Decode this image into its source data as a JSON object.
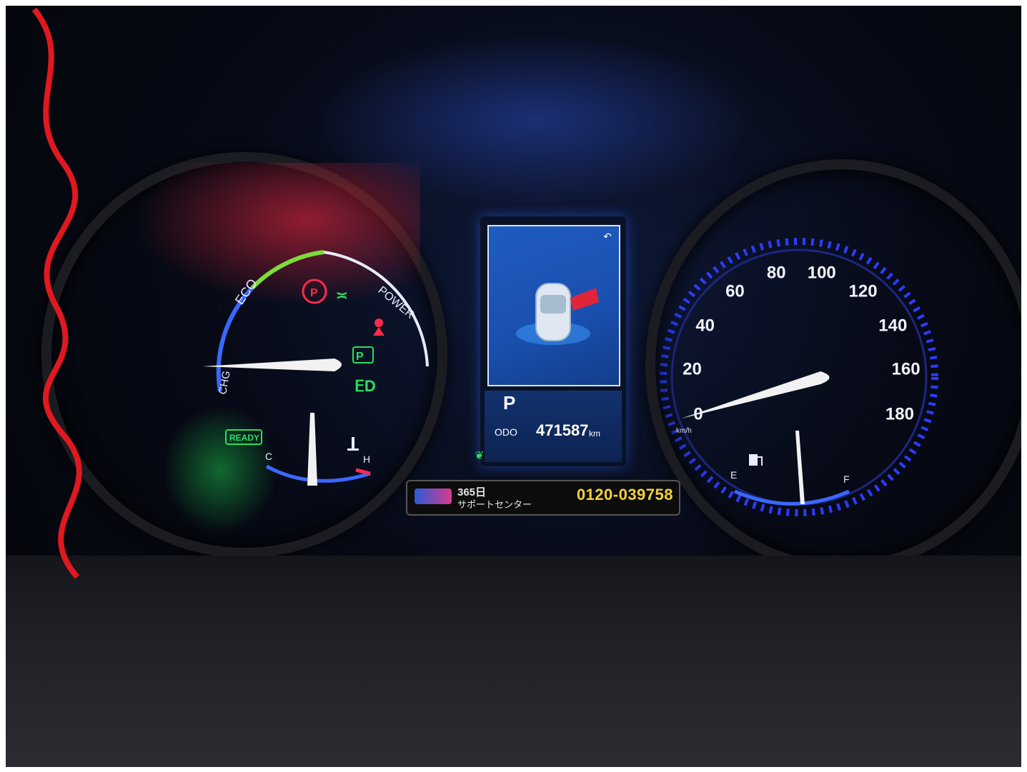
{
  "hybrid_gauge": {
    "labels": {
      "eco": "ECO",
      "power": "POWER",
      "chg": "CHG",
      "cold": "C",
      "hot": "H",
      "ready": "READY"
    },
    "colors": {
      "eco_arc": "#7ddc3a",
      "arc": "#3a68ff",
      "needle": "#f2f2f2",
      "warning": "#ff2a4a",
      "indicator_green": "#28e060"
    },
    "icons": [
      "parking-brake-icon",
      "headlight-icon",
      "seatbelt-warning-icon",
      "parking-p-icon",
      "fog-light-icon",
      "coolant-temp-icon"
    ]
  },
  "center_display": {
    "gear": "P",
    "odo_label": "ODO",
    "odometer": "471587",
    "odometer_unit": "km",
    "icons": [
      "back-arrow-icon",
      "car-door-open-icon",
      "eco-leaf-icon"
    ]
  },
  "speedometer": {
    "ticks": [
      "0",
      "20",
      "40",
      "60",
      "80",
      "100",
      "120",
      "140",
      "160",
      "180"
    ],
    "unit": "km/h",
    "speed": 0,
    "fuel_empty": "E",
    "fuel_full": "F",
    "colors": {
      "ring": "#2c3cff",
      "needle": "#f2f2f2"
    },
    "icons": [
      "fuel-pump-icon"
    ]
  },
  "sticker": {
    "days": "365日",
    "center": "サポートセンター",
    "phone": "0120-039758"
  }
}
